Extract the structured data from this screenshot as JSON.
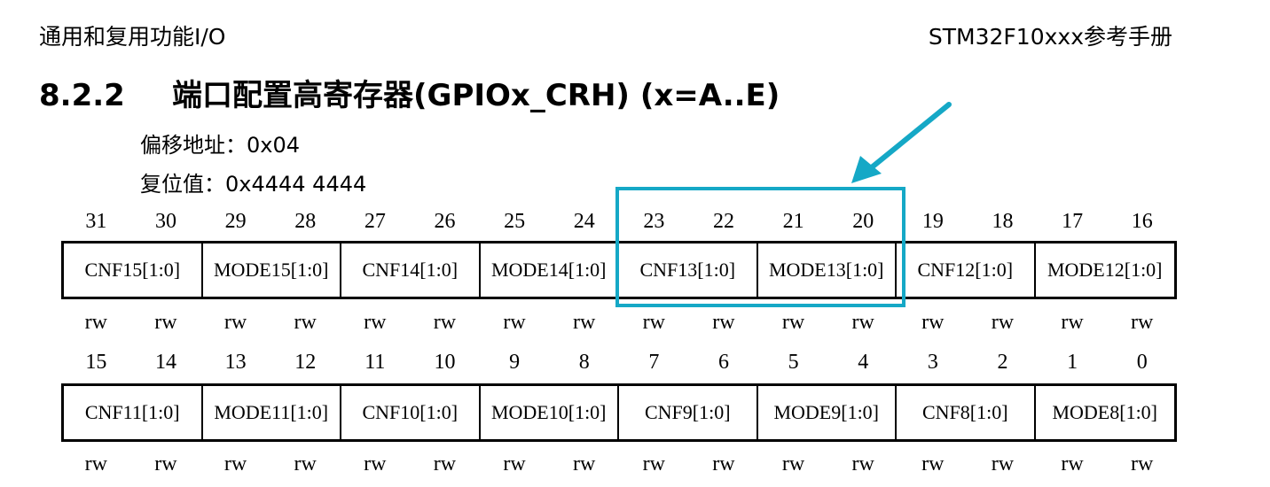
{
  "header": {
    "left": "通用和复用功能I/O",
    "right": "STM32F10xxx参考手册"
  },
  "section": {
    "number": "8.2.2",
    "title": "端口配置高寄存器(GPIOx_CRH) (x=A..E)"
  },
  "offset": {
    "label": "偏移地址：",
    "value": "0x04"
  },
  "reset": {
    "label": "复位值：",
    "value": "0x4444 4444"
  },
  "upper": {
    "bits": [
      "31",
      "30",
      "29",
      "28",
      "27",
      "26",
      "25",
      "24",
      "23",
      "22",
      "21",
      "20",
      "19",
      "18",
      "17",
      "16"
    ],
    "fields": [
      "CNF15[1:0]",
      "MODE15[1:0]",
      "CNF14[1:0]",
      "MODE14[1:0]",
      "CNF13[1:0]",
      "MODE13[1:0]",
      "CNF12[1:0]",
      "MODE12[1:0]"
    ],
    "access": [
      "rw",
      "rw",
      "rw",
      "rw",
      "rw",
      "rw",
      "rw",
      "rw",
      "rw",
      "rw",
      "rw",
      "rw",
      "rw",
      "rw",
      "rw",
      "rw"
    ]
  },
  "lower": {
    "bits": [
      "15",
      "14",
      "13",
      "12",
      "11",
      "10",
      "9",
      "8",
      "7",
      "6",
      "5",
      "4",
      "3",
      "2",
      "1",
      "0"
    ],
    "fields": [
      "CNF11[1:0]",
      "MODE11[1:0]",
      "CNF10[1:0]",
      "MODE10[1:0]",
      "CNF9[1:0]",
      "MODE9[1:0]",
      "CNF8[1:0]",
      "MODE8[1:0]"
    ],
    "access": [
      "rw",
      "rw",
      "rw",
      "rw",
      "rw",
      "rw",
      "rw",
      "rw",
      "rw",
      "rw",
      "rw",
      "rw",
      "rw",
      "rw",
      "rw",
      "rw"
    ]
  },
  "colors": {
    "highlight": "#15a8c6"
  },
  "annotation_icon": "arrow-icon"
}
